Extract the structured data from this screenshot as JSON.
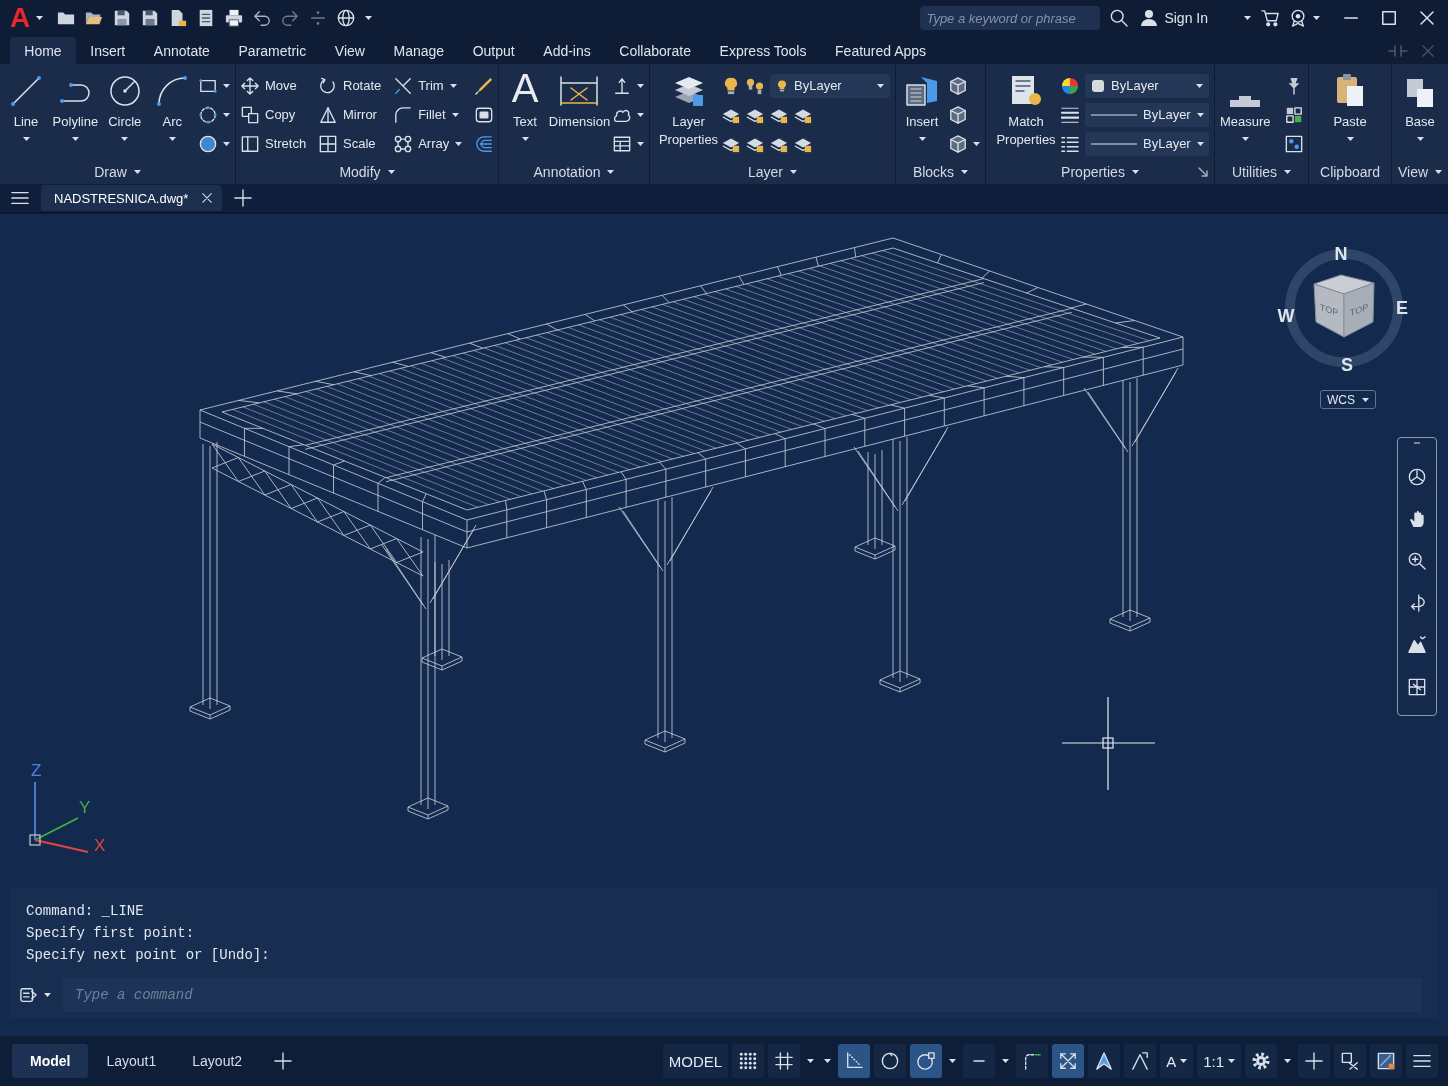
{
  "title_bar": {
    "logo": "A",
    "search": {
      "placeholder": "Type a keyword or phrase"
    },
    "sign_in": "Sign In"
  },
  "menu_tabs": [
    {
      "label": "Home",
      "selected": true
    },
    {
      "label": "Insert",
      "selected": false
    },
    {
      "label": "Annotate",
      "selected": false
    },
    {
      "label": "Parametric",
      "selected": false
    },
    {
      "label": "View",
      "selected": false
    },
    {
      "label": "Manage",
      "selected": false
    },
    {
      "label": "Output",
      "selected": false
    },
    {
      "label": "Add-ins",
      "selected": false
    },
    {
      "label": "Collaborate",
      "selected": false
    },
    {
      "label": "Express Tools",
      "selected": false
    },
    {
      "label": "Featured Apps",
      "selected": false
    }
  ],
  "ribbon": {
    "panels": [
      {
        "title": "Draw",
        "expandable": true,
        "large": [
          {
            "label": "Line",
            "dropdown": true
          },
          {
            "label": "Polyline",
            "dropdown": true
          },
          {
            "label": "Circle",
            "dropdown": true
          },
          {
            "label": "Arc",
            "dropdown": true
          }
        ],
        "columns": [
          [
            {
              "dropdown": true
            },
            {
              "dropdown": true
            },
            {
              "dropdown": true
            }
          ]
        ]
      },
      {
        "title": "Modify",
        "expandable": true,
        "columns": [
          [
            {
              "label": "Move",
              "dropdown": false
            },
            {
              "label": "Copy",
              "dropdown": false
            },
            {
              "label": "Stretch",
              "dropdown": false
            }
          ],
          [
            {
              "label": "Rotate",
              "dropdown": false
            },
            {
              "label": "Mirror",
              "dropdown": false
            },
            {
              "label": "Scale",
              "dropdown": false
            }
          ],
          [
            {
              "label": "Trim",
              "dropdown": true
            },
            {
              "label": "Fillet",
              "dropdown": true
            },
            {
              "label": "Array",
              "dropdown": true
            }
          ],
          [
            {
              "dropdown": false
            },
            {
              "dropdown": false
            },
            {
              "dropdown": false
            }
          ]
        ]
      },
      {
        "title": "Annotation",
        "expandable": true,
        "large": [
          {
            "label": "Text",
            "glyph": "A",
            "dropdown": true
          },
          {
            "label": "Dimension",
            "dropdown": false
          }
        ],
        "columns": [
          [
            {
              "dropdown": true
            },
            {
              "dropdown": true
            },
            {
              "dropdown": true
            }
          ]
        ]
      },
      {
        "title": "Layer",
        "expandable": true,
        "large": [
          {
            "label": "Layer Properties",
            "dropdown": false
          }
        ],
        "rows": [
          [
            {
              "kind": "tool"
            },
            {
              "kind": "tool"
            },
            {
              "kind": "layer_list",
              "value": "ByLayer"
            }
          ],
          [
            {
              "kind": "tool"
            },
            {
              "kind": "tool"
            },
            {
              "kind": "tool"
            },
            {
              "kind": "tool"
            }
          ],
          [
            {
              "kind": "tool"
            },
            {
              "kind": "tool"
            },
            {
              "kind": "tool"
            },
            {
              "kind": "tool"
            }
          ]
        ]
      },
      {
        "title": "Blocks",
        "expandable": true,
        "large": [
          {
            "label": "Insert",
            "dropdown": true
          }
        ],
        "columns": [
          [
            {
              "dropdown": false
            },
            {
              "dropdown": false
            },
            {
              "dropdown": true
            }
          ]
        ]
      },
      {
        "title": "Properties",
        "expandable": true,
        "launcher": true,
        "large": [
          {
            "label": "Match Properties",
            "dropdown": false
          }
        ],
        "rows": [
          [
            {
              "kind": "tool"
            },
            {
              "kind": "color_list",
              "value": "ByLayer"
            }
          ],
          [
            {
              "kind": "tool"
            },
            {
              "kind": "line_list",
              "value": "ByLayer"
            }
          ],
          [
            {
              "kind": "tool"
            },
            {
              "kind": "line_list",
              "value": "ByLayer"
            }
          ]
        ]
      },
      {
        "title": "Utilities",
        "expandable": true,
        "large": [
          {
            "label": "Measure",
            "dropdown": true
          }
        ],
        "columns": [
          [
            {
              "dropdown": false
            },
            {
              "dropdown": false
            },
            {
              "dropdown": false
            }
          ]
        ]
      },
      {
        "title": "Clipboard",
        "expandable": false,
        "large": [
          {
            "label": "Paste",
            "dropdown": true
          }
        ]
      },
      {
        "title": "View",
        "expandable": true,
        "large": [
          {
            "label": "Base",
            "dropdown": true
          }
        ]
      }
    ]
  },
  "file_tabs": [
    {
      "label": "NADSTRESNICA.dwg*",
      "selected": true
    }
  ],
  "viewport": {
    "compass": {
      "north": "N",
      "east": "E",
      "south": "S",
      "west": "W"
    },
    "cube_faces": [
      "TOP",
      "TOP"
    ],
    "ucs_menu": "WCS",
    "axes": [
      "Z",
      "Y",
      "X"
    ]
  },
  "command_line": {
    "history": [
      "Command: _LINE",
      "Specify first point:",
      "Specify next point or [Undo]:"
    ],
    "placeholder": "Type a command"
  },
  "layout_tabs": [
    {
      "label": "Model",
      "selected": true
    },
    {
      "label": "Layout1",
      "selected": false
    },
    {
      "label": "Layout2",
      "selected": false
    }
  ],
  "status_bar": {
    "mode": "MODEL",
    "items": [
      {
        "kind": "toggle",
        "on": false
      },
      {
        "kind": "toggle",
        "on": false
      },
      {
        "kind": "menu"
      },
      {
        "kind": "menu"
      },
      {
        "kind": "toggle",
        "on": true
      },
      {
        "kind": "toggle",
        "on": false
      },
      {
        "kind": "toggle",
        "on": true
      },
      {
        "kind": "menu"
      },
      {
        "kind": "toggle",
        "on": false
      },
      {
        "kind": "menu"
      },
      {
        "kind": "toggle",
        "on": false
      },
      {
        "kind": "toggle",
        "on": true
      },
      {
        "kind": "toggle",
        "on": false
      },
      {
        "kind": "toggle",
        "on": false
      },
      {
        "kind": "scale",
        "label": "A"
      },
      {
        "kind": "scale",
        "label": "1:1"
      },
      {
        "kind": "toggle",
        "on": false
      },
      {
        "kind": "menu"
      },
      {
        "kind": "toggle",
        "on": false
      },
      {
        "kind": "toggle",
        "on": false
      },
      {
        "kind": "toggle",
        "on": false
      },
      {
        "kind": "toggle",
        "on": false
      }
    ]
  }
}
